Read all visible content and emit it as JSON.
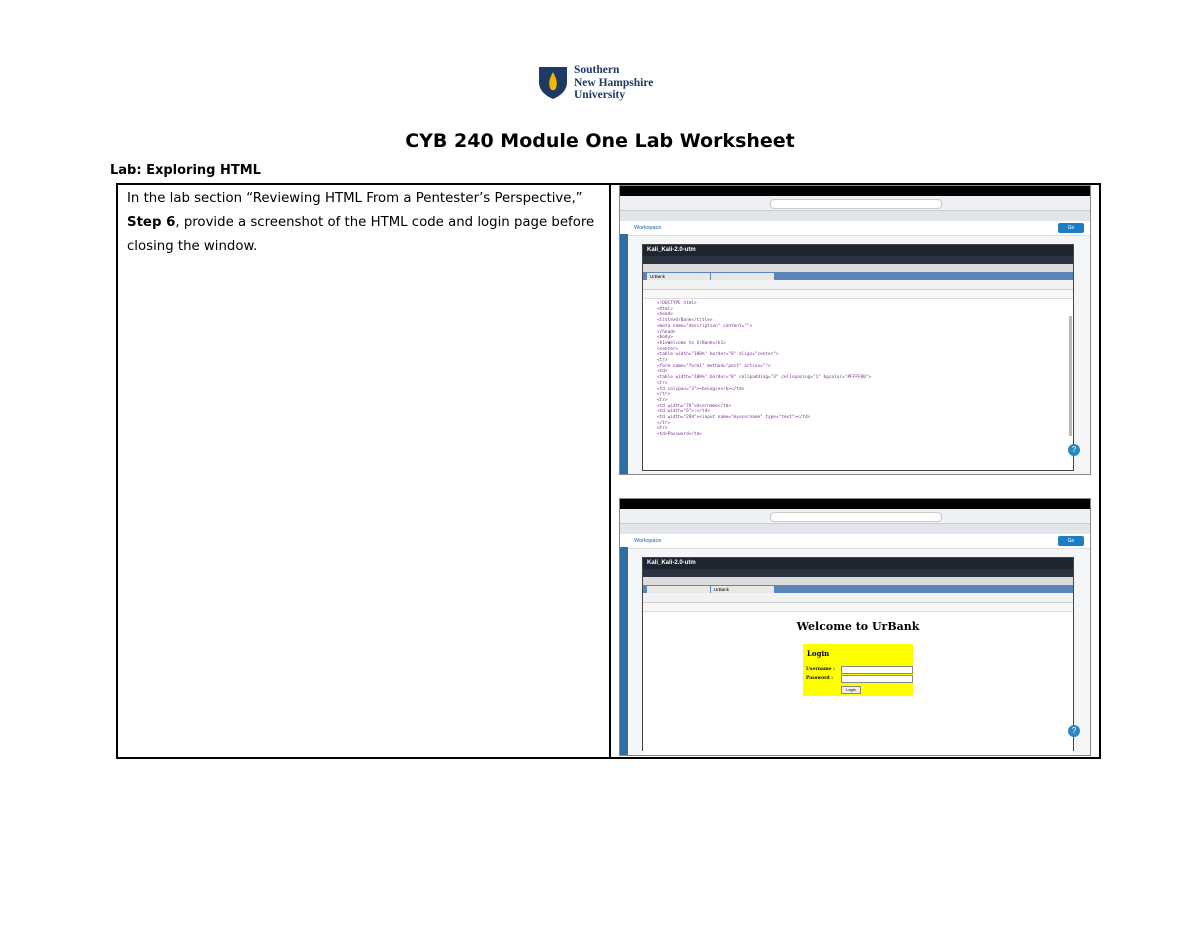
{
  "logo": {
    "line1": "Southern",
    "line2": "New Hampshire",
    "line3": "University"
  },
  "title": "CYB 240 Module One Lab Worksheet",
  "lab_heading": "Lab: Exploring HTML",
  "instructions": {
    "text_before": "In the lab section “Reviewing HTML From a Pentester’s Perspective,”",
    "step": "Step 6",
    "text_after": ", provide a screenshot of the HTML code and login page before closing the window."
  },
  "shot1": {
    "url": "",
    "workspace": "Workspace",
    "vm_name": "Kali_Kali-2.0-utm",
    "timestamp": "",
    "go": "Go",
    "window_title": "",
    "tab1": "UrBank",
    "tab2": "",
    "code_lines": [
      "<!DOCTYPE html>",
      "<html>",
      "<head>",
      "<title>UrBank</title>",
      "<meta name=\"description\" content=\"\">",
      "</head>",
      "<body>",
      "<h1>Welcome to UrBank</h1>",
      "<center>",
      "<table width=\"100%\" border=\"0\" align=\"center\">",
      "<tr>",
      "<form name=\"form1\" method=\"post\" action=\"\">",
      "<td>",
      "<table width=\"100%\" border=\"0\" cellpadding=\"3\" cellspacing=\"1\" bgcolor=\"#FFFF00\">",
      "<tr>",
      "<td colspan=\"3\"><b>Login</b></td>",
      "</tr>",
      "<tr>",
      "<td width=\"78\">Username</td>",
      "<td width=\"6\">:</td>",
      "<td width=\"294\"><input name=\"myusername\" type=\"text\"></td>",
      "</tr>",
      "<tr>",
      "<td>Password</td>"
    ]
  },
  "shot2": {
    "workspace": "Workspace",
    "vm_name": "Kali_Kali-2.0-utm",
    "go": "Go",
    "tab1": "UrBank",
    "welcome": "Welcome to UrBank",
    "login_heading": "Login",
    "username_label": "Username :",
    "password_label": "Password :",
    "submit_label": "Login"
  }
}
